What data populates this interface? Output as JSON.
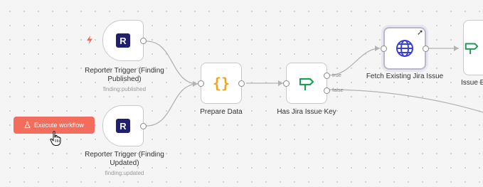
{
  "execute_button": {
    "label": "Execute workflow",
    "icon": "flask-icon"
  },
  "nodes": {
    "trigger_published": {
      "label": "Reporter Trigger (Finding\nPublished)",
      "sublabel": "finding:published",
      "icon": "reporter-logo",
      "logo_letter": "R",
      "badge_icon": "lightning-bolt-icon"
    },
    "trigger_updated": {
      "label": "Reporter Trigger (Finding\nUpdated)",
      "sublabel": "finding:updated",
      "icon": "reporter-logo",
      "logo_letter": "R"
    },
    "prepare_data": {
      "label": "Prepare Data",
      "icon": "code-braces-icon",
      "icon_glyph": "{}"
    },
    "has_jira_issue_key": {
      "label": "Has Jira Issue Key",
      "icon": "signpost-icon",
      "branches": {
        "true_label": "true",
        "false_label": "false"
      }
    },
    "fetch_existing_jira_issue": {
      "label": "Fetch Existing Jira Issue",
      "icon": "globe-icon",
      "corner_icon": "arrow-top-right-icon",
      "corner_glyph": "➚"
    },
    "issue_partial": {
      "label": "Issue E",
      "icon": "signpost-icon"
    }
  },
  "colors": {
    "execute_button": "#f26d5b",
    "reporter_logo": "#20206e",
    "braces": "#f2a41f",
    "signpost": "#1f9c55",
    "globe": "#3b3fd8",
    "edge": "#b3b3b3"
  }
}
